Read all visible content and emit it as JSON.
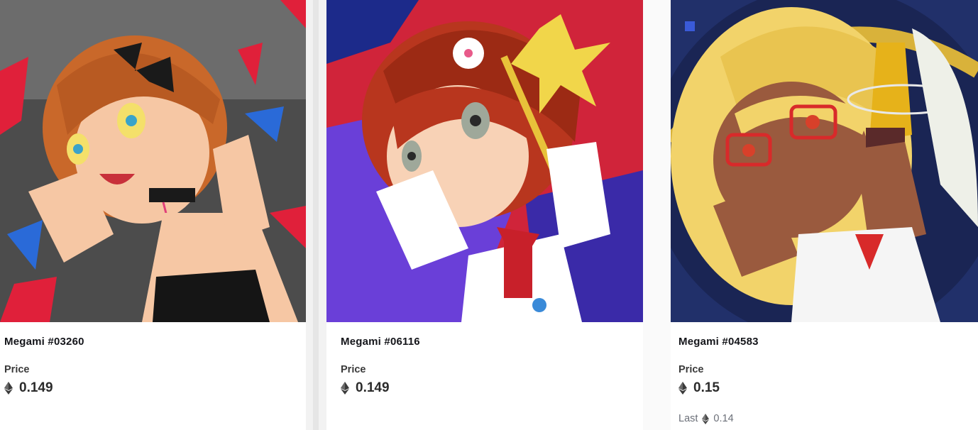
{
  "cards": [
    {
      "name": "Megami #03260",
      "price_label": "Price",
      "price": "0.149",
      "currency_icon": "ethereum-icon",
      "art_palette": {
        "bg": "#5a5a5a",
        "accent": "#e0203a",
        "hair": "#c9682a",
        "skin": "#f6c7a4"
      }
    },
    {
      "name": "Megami #06116",
      "price_label": "Price",
      "price": "0.149",
      "currency_icon": "ethereum-icon",
      "art_palette": {
        "bg": "#d0243a",
        "accent": "#6a3fd8",
        "hair": "#b8361e",
        "skin": "#f8d2b6"
      }
    },
    {
      "name": "Megami #04583",
      "price_label": "Price",
      "price": "0.15",
      "currency_icon": "ethereum-icon",
      "last_label": "Last",
      "last_price": "0.14",
      "art_palette": {
        "bg": "#21306a",
        "accent": "#e8c23a",
        "hair": "#f2d36a",
        "skin": "#9a5a3e"
      }
    }
  ]
}
